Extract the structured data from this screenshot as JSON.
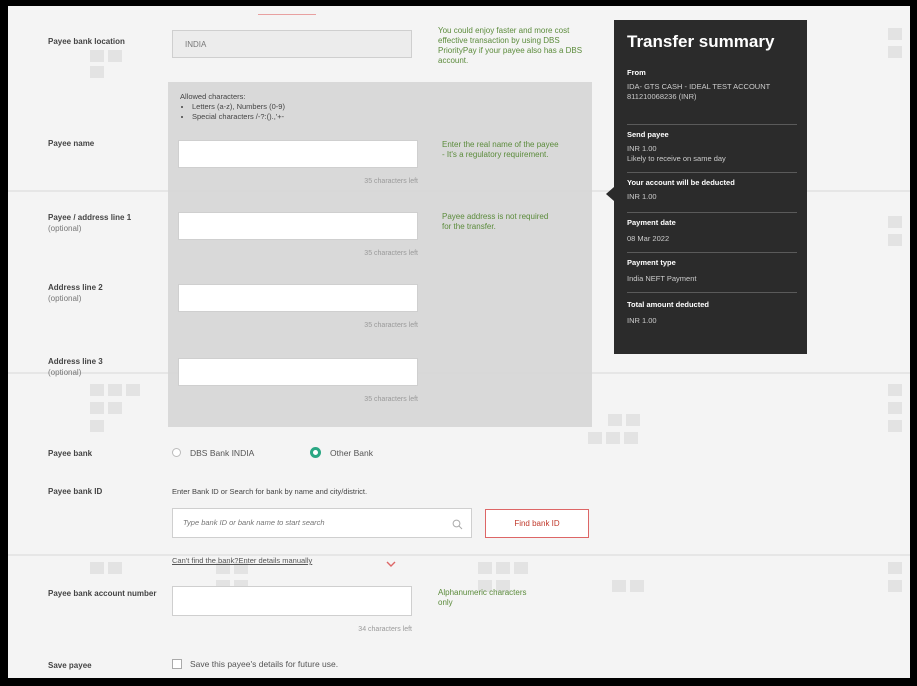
{
  "form": {
    "payee_bank_location": {
      "label": "Payee bank location",
      "value": "INDIA"
    },
    "location_hint": "You could enjoy faster and more cost effective transaction by using DBS PriorityPay if your payee also has a DBS account.",
    "allowed": {
      "title": "Allowed characters:",
      "items": [
        "Letters (a-z), Numbers (0-9)",
        "Special characters /-?:().,'+-"
      ]
    },
    "payee_name": {
      "label": "Payee name",
      "counter": "35 characters left",
      "hint": "Enter the real name of the payee - It's a regulatory requirement."
    },
    "address1": {
      "label": "Payee / address line 1",
      "optional": "(optional)",
      "counter": "35 characters left",
      "hint": "Payee address is not required for the transfer."
    },
    "address2": {
      "label": "Address line 2",
      "optional": "(optional)",
      "counter": "35 characters left"
    },
    "address3": {
      "label": "Address line 3",
      "optional": "(optional)",
      "counter": "35 characters left"
    },
    "payee_bank": {
      "label": "Payee bank",
      "option1": "DBS Bank INDIA",
      "option2": "Other Bank",
      "selected": "Other Bank"
    },
    "payee_bank_id": {
      "label": "Payee bank ID",
      "instruction": "Enter Bank ID or Search for bank by name and city/district.",
      "placeholder": "Type bank ID or bank name to start search",
      "button": "Find bank ID",
      "manual_link": "Can't find the bank?Enter details manually"
    },
    "account_number": {
      "label": "Payee bank account number",
      "counter": "34 characters left",
      "hint": "Alphanumeric characters only"
    },
    "save_payee": {
      "label": "Save payee",
      "checkbox_label": "Save this payee's details for future use."
    }
  },
  "summary": {
    "title": "Transfer summary",
    "from_h": "From",
    "from_v": "IDA- GTS CASH - IDEAL TEST ACCOUNT 811210068236 (INR)",
    "send_h": "Send payee",
    "send_v1": "INR 1.00",
    "send_v2": "Likely to receive on same day",
    "deduct_h": "Your account will be deducted",
    "deduct_v": "INR 1.00",
    "date_h": "Payment date",
    "date_v": "08 Mar 2022",
    "type_h": "Payment type",
    "type_v": "India NEFT Payment",
    "total_h": "Total amount deducted",
    "total_v": "INR 1.00"
  },
  "colors": {
    "accent": "#2aa783",
    "danger": "#c0392b",
    "summary_bg": "#2b2b2b",
    "hint_text": "#5b8b3b"
  }
}
